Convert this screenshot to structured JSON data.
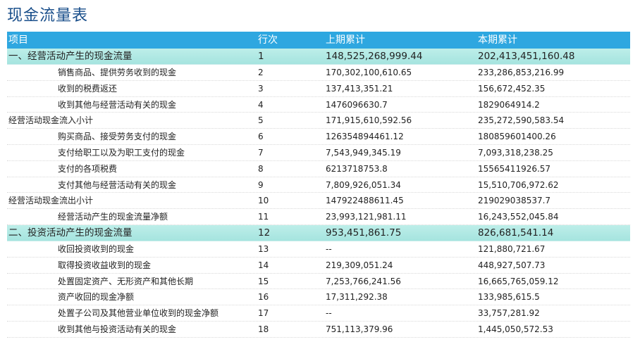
{
  "title": "现金流量表",
  "header": {
    "item": "项目",
    "idx": "行次",
    "prev": "上期累计",
    "curr": "本期累计"
  },
  "rows": [
    {
      "type": "section",
      "name": "一、经营活动产生的现金流量",
      "idx": "1",
      "prev": "148,525,268,999.44",
      "curr": "202,413,451,160.48"
    },
    {
      "type": "sub",
      "name": "销售商品、提供劳务收到的现金",
      "idx": "2",
      "prev": "170,302,100,610.65",
      "curr": "233,286,853,216.99"
    },
    {
      "type": "sub",
      "name": "收到的税费返还",
      "idx": "3",
      "prev": "137,413,351.21",
      "curr": "156,672,452.35"
    },
    {
      "type": "sub",
      "name": "收到其他与经营活动有关的现金",
      "idx": "4",
      "prev": "1476096630.7",
      "curr": "1829064914.2"
    },
    {
      "type": "plain",
      "name": "经营活动现金流入小计",
      "idx": "5",
      "prev": "171,915,610,592.56",
      "curr": "235,272,590,583.54"
    },
    {
      "type": "sub",
      "name": "购买商品、接受劳务支付的现金",
      "idx": "6",
      "prev": "126354894461.12",
      "curr": "180859601400.26"
    },
    {
      "type": "sub",
      "name": "支付给职工以及为职工支付的现金",
      "idx": "7",
      "prev": "7,543,949,345.19",
      "curr": "7,093,318,238.25"
    },
    {
      "type": "sub",
      "name": "支付的各项税费",
      "idx": "8",
      "prev": "6213718753.8",
      "curr": "15565411926.57"
    },
    {
      "type": "sub",
      "name": "支付其他与经营活动有关的现金",
      "idx": "9",
      "prev": "7,809,926,051.34",
      "curr": "15,510,706,972.62"
    },
    {
      "type": "plain",
      "name": "经营活动现金流出小计",
      "idx": "10",
      "prev": "147922488611.45",
      "curr": "219029038537.7"
    },
    {
      "type": "sub",
      "name": "经营活动产生的现金流量净额",
      "idx": "11",
      "prev": "23,993,121,981.11",
      "curr": "16,243,552,045.84"
    },
    {
      "type": "section",
      "name": "二、投资活动产生的现金流量",
      "idx": "12",
      "prev": "953,451,861.75",
      "curr": "826,681,541.14"
    },
    {
      "type": "sub",
      "name": "收回投资收到的现金",
      "idx": "13",
      "prev": "--",
      "curr": "121,880,721.67"
    },
    {
      "type": "sub",
      "name": "取得投资收益收到的现金",
      "idx": "14",
      "prev": "219,309,051.24",
      "curr": "448,927,507.73"
    },
    {
      "type": "sub",
      "name": "处置固定资产、无形资产和其他长期",
      "idx": "15",
      "prev": "7,253,766,241.56",
      "curr": "16,665,765,059.12"
    },
    {
      "type": "sub",
      "name": "资产收回的现金净额",
      "idx": "16",
      "prev": "17,311,292.38",
      "curr": "133,985,615.5"
    },
    {
      "type": "sub",
      "name": "处置子公司及其他营业单位收到的现金净额",
      "idx": "17",
      "prev": "--",
      "curr": "33,757,281.92"
    },
    {
      "type": "sub",
      "name": "收到其他与投资活动有关的现金",
      "idx": "18",
      "prev": "751,113,379.96",
      "curr": "1,445,050,572.53"
    }
  ]
}
